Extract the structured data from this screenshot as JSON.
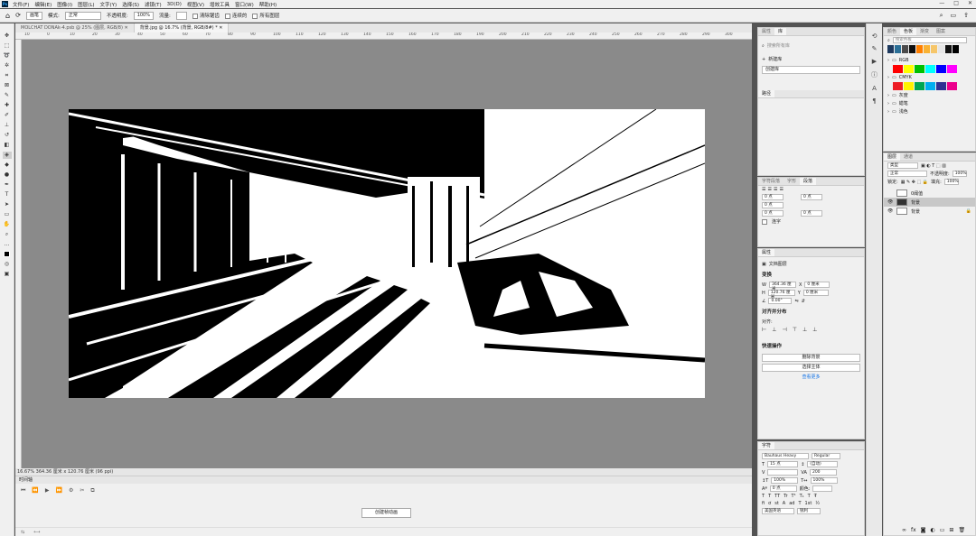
{
  "menu": {
    "logo": "Ps",
    "items": [
      "文件(F)",
      "编辑(E)",
      "图像(I)",
      "图层(L)",
      "文字(Y)",
      "选择(S)",
      "滤镜(T)",
      "3D(D)",
      "视图(V)",
      "增效工具",
      "窗口(W)",
      "帮助(H)"
    ],
    "window_controls": [
      "—",
      "□",
      "✕"
    ]
  },
  "options": {
    "brush_label": "画笔",
    "mode_label": "模式:",
    "mode_value": "正常",
    "opacity_label": "不透明度:",
    "opacity_value": "100%",
    "flow_label": "流量:",
    "cb1": "清除锯齿",
    "cb2": "连续的",
    "cb3": "所有图层"
  },
  "doc_tabs": [
    {
      "label": "MOLCHAT DONAk-4.psb @ 25% (图层, RGB/8) ✕"
    },
    {
      "label": "背景.jpg @ 16.7% (背景, RGB/8#) * ✕"
    }
  ],
  "ruler_ticks": [
    "10",
    "0",
    "10",
    "20",
    "30",
    "40",
    "50",
    "60",
    "70",
    "80",
    "90",
    "100",
    "110",
    "120",
    "130",
    "140",
    "150",
    "160",
    "170",
    "180",
    "190",
    "200",
    "210",
    "220",
    "230",
    "240",
    "250",
    "260",
    "270",
    "280",
    "290",
    "300"
  ],
  "status": {
    "text": "16.67%  364.36 厘米 x 120.76 厘米 (96 ppi)"
  },
  "timeline": {
    "title": "时间轴",
    "create_btn": "创建帧动画",
    "foot_icons": [
      "⏮",
      "⏪",
      "▶",
      "⏩",
      "⚙",
      "✂",
      "⧉"
    ]
  },
  "panel_libs": {
    "tabs": [
      "属性",
      "库"
    ],
    "search_placeholder": "搜索所有库",
    "new_lib": "新建库",
    "lib_item": "创建库",
    "section": "路径"
  },
  "panel_char_adjust": {
    "tabs": [
      "字符段落",
      "字形",
      "段落"
    ],
    "fields": [
      "0 点",
      "0 点",
      "0 点",
      "0 点",
      "0 点"
    ],
    "hyphen": "连字"
  },
  "panel_props": {
    "title": "属性",
    "doc_label": "文档图层",
    "transform": "变换",
    "w_label": "W",
    "w_value": "364.36 厘米",
    "h_label": "H",
    "h_value": "120.76 厘米",
    "x_value": "0 厘米",
    "y_value": "0 厘米",
    "angle": "0.00°",
    "align_title": "对齐并分布",
    "align_label": "对齐:",
    "quick_title": "快速操作",
    "quick_btn1": "删除背景",
    "quick_btn2": "选择主体",
    "quick_link": "查看更多"
  },
  "panel_char": {
    "title": "字符",
    "font": "Bauhaus Heavy",
    "style": "Regular",
    "size": "15 点",
    "leading": "(自动)",
    "tracking": "200",
    "scale_v": "100%",
    "scale_h": "100%",
    "baseline": "0 点",
    "color_label": "颜色:",
    "lang": "美国英语",
    "aa": "锐利"
  },
  "panel_swatches": {
    "tabs": [
      "颜色",
      "色板",
      "渐变",
      "图案"
    ],
    "search_placeholder": "搜索色板",
    "recent": [
      "#1e3a5f",
      "#2a6f97",
      "#4b4b4b",
      "#0f0f0f",
      "#ff7f00",
      "#f9b234",
      "#f6c66a",
      "#e6e6e6",
      "#111111",
      "#000000"
    ],
    "groups": [
      {
        "name": "RGB",
        "colors": [
          "#ff0000",
          "#ffff00",
          "#00c000",
          "#00ffff",
          "#0000ff",
          "#ff00ff"
        ]
      },
      {
        "name": "CMYK",
        "colors": [
          "#ed1c24",
          "#fff200",
          "#00a651",
          "#00aeef",
          "#2e3192",
          "#ec008c"
        ]
      },
      {
        "name": "灰度"
      },
      {
        "name": "蜡笔"
      },
      {
        "name": "浅色"
      }
    ]
  },
  "panel_layers": {
    "tabs": [
      "图层",
      "通道"
    ],
    "kind": "类型",
    "blend": "正常",
    "opacity_label": "不透明度:",
    "opacity_value": "100%",
    "lock_label": "锁定:",
    "fill_label": "填充:",
    "fill_value": "100%",
    "layers": [
      {
        "name": "0阈值",
        "visible": false,
        "selected": false
      },
      {
        "name": "背景",
        "visible": true,
        "selected": true
      },
      {
        "name": "背景",
        "visible": true,
        "selected": false
      }
    ]
  }
}
